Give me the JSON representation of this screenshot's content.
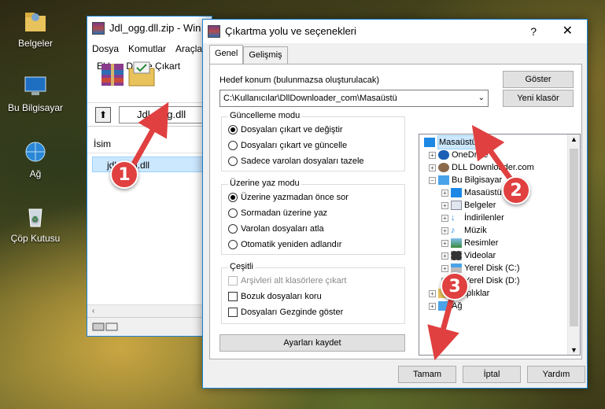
{
  "desktop": {
    "icons": [
      {
        "label": "Belgeler"
      },
      {
        "label": "Bu Bilgisayar"
      },
      {
        "label": "Ağ"
      },
      {
        "label": "Çöp Kutusu"
      }
    ]
  },
  "winrar": {
    "title": "Jdl_ogg.dll.zip - Win",
    "menu": [
      "Dosya",
      "Komutlar",
      "Araçla"
    ],
    "toolbar": {
      "add_label": "Ekle",
      "extract_label": "Dizine Çıkart"
    },
    "path": "Jdl_ogg.dll",
    "column_name": "İsim",
    "file": "jdl_ogg.dll"
  },
  "dialog": {
    "title": "Çıkartma yolu ve seçenekleri",
    "help": "?",
    "close": "✕",
    "tabs": [
      "Genel",
      "Gelişmiş"
    ],
    "dest_label": "Hedef konum (bulunmazsa oluşturulacak)",
    "dest_value": "C:\\Kullanıcılar\\DllDownloader_com\\Masaüstü",
    "show_button": "Göster",
    "new_folder_button": "Yeni klasör",
    "update_mode": {
      "title": "Güncelleme modu",
      "options": [
        "Dosyaları çıkart ve değiştir",
        "Dosyaları çıkart ve güncelle",
        "Sadece varolan dosyaları tazele"
      ],
      "selected": 0
    },
    "overwrite_mode": {
      "title": "Üzerine yaz modu",
      "options": [
        "Üzerine yazmadan önce sor",
        "Sormadan üzerine yaz",
        "Varolan dosyaları atla",
        "Otomatik yeniden adlandır"
      ],
      "selected": 0
    },
    "misc": {
      "title": "Çeşitli",
      "options": [
        "Arşivleri alt klasörlere çıkart",
        "Bozuk dosyaları koru",
        "Dosyaları Gezginde göster"
      ]
    },
    "save_settings": "Ayarları kaydet",
    "tree": [
      "Masaüstü",
      "OneDrive",
      "DLL Downloader.com",
      "Bu Bilgisayar",
      "Masaüstü",
      "Belgeler",
      "İndirilenler",
      "Müzik",
      "Resimler",
      "Videolar",
      "Yerel Disk (C:)",
      "Yerel Disk (D:)",
      "Kitaplıklar",
      "Ağ"
    ],
    "ok": "Tamam",
    "cancel": "İptal",
    "help_button": "Yardım"
  },
  "annotations": [
    "1",
    "2",
    "3"
  ],
  "colors": {
    "accent": "#1883d7",
    "badge": "#e04040"
  }
}
